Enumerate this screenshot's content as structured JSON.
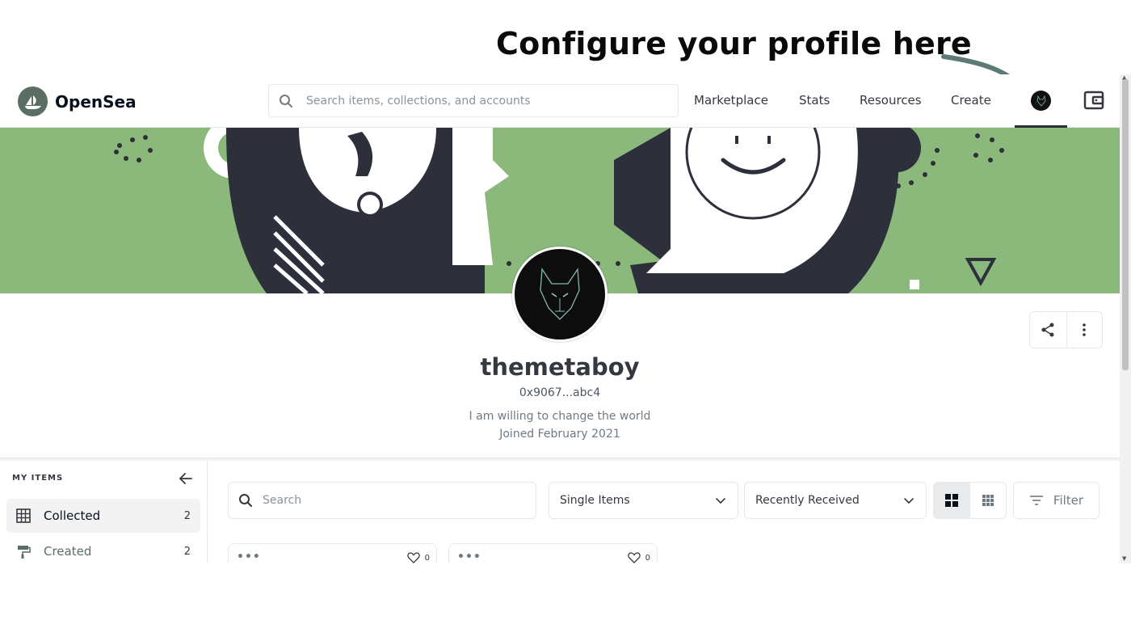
{
  "annotation": {
    "text": "Configure your profile here"
  },
  "navbar": {
    "logo_text": "OpenSea",
    "search_placeholder": "Search items, collections, and accounts",
    "links": [
      "Marketplace",
      "Stats",
      "Resources",
      "Create"
    ]
  },
  "profile": {
    "username": "themetaboy",
    "address": "0x9067...abc4",
    "bio": "I am willing to change the world",
    "joined": "Joined February 2021"
  },
  "sidebar": {
    "title": "MY ITEMS",
    "items": [
      {
        "label": "Collected",
        "count": "2"
      },
      {
        "label": "Created",
        "count": "2"
      }
    ]
  },
  "filters": {
    "search_placeholder": "Search",
    "item_type": "Single Items",
    "sort": "Recently Received",
    "filter_label": "Filter"
  },
  "cards": [
    {
      "favorites": "0"
    },
    {
      "favorites": "0"
    }
  ],
  "colors": {
    "banner": "#8bb97c",
    "banner_dark": "#2d2f3b",
    "logo": "#5b6e63",
    "arrow": "#5e7a77"
  }
}
